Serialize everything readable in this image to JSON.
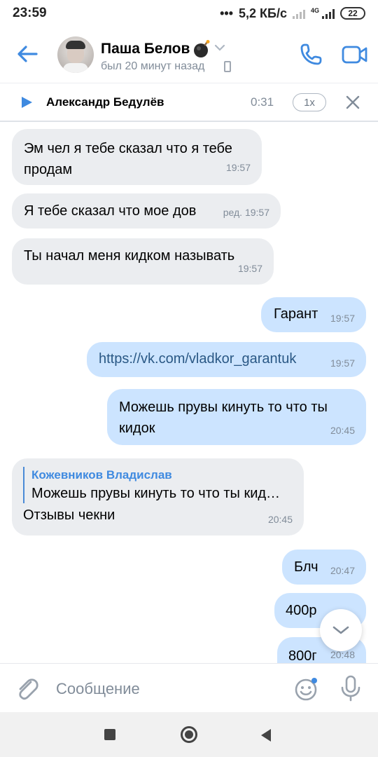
{
  "status_bar": {
    "time": "23:59",
    "network_speed": "5,2 КБ/с",
    "network_type": "4G",
    "battery": "22"
  },
  "header": {
    "contact_name": "Паша Белов",
    "last_seen": "был 20 минут назад",
    "accent_color": "#3f8ae0"
  },
  "player": {
    "title": "Александр Бедулёв",
    "time": "0:31",
    "speed": "1x"
  },
  "messages": [
    {
      "direction": "in",
      "text_lines": [
        "Эм чел я тебе сказал что я тебе",
        "продам"
      ],
      "time": "19:57"
    },
    {
      "direction": "in",
      "text_lines": [
        "Я тебе сказал что мое дов"
      ],
      "time": "ред. 19:57"
    },
    {
      "direction": "in",
      "text_lines": [
        "Ты начал меня кидком называть"
      ],
      "time": "19:57"
    },
    {
      "direction": "out",
      "text_lines": [
        "Гарант"
      ],
      "time": "19:57"
    },
    {
      "direction": "out",
      "text_lines": [
        "https://vk.com/vladkor_garantuk"
      ],
      "time": "19:57"
    },
    {
      "direction": "out",
      "text_lines": [
        "Можешь прувы кинуть то что ты",
        "кидок"
      ],
      "time": "20:45"
    },
    {
      "direction": "in",
      "reply_author": "Кожевников Владислав",
      "reply_text": "Можешь прувы кинуть то что ты кид…",
      "text_lines": [
        "Отзывы чекни"
      ],
      "time": "20:45"
    },
    {
      "direction": "out",
      "text_lines": [
        "Блч"
      ],
      "time": "20:47"
    },
    {
      "direction": "out",
      "text_lines": [
        "400р"
      ],
      "time": ""
    },
    {
      "direction": "out",
      "text_lines": [
        "800г"
      ],
      "time": "20:48"
    }
  ],
  "composer": {
    "placeholder": "Сообщение"
  }
}
